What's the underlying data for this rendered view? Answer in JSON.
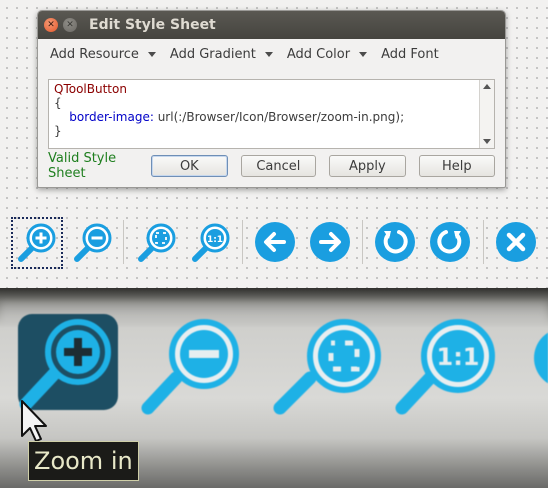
{
  "dialog": {
    "title": "Edit Style Sheet",
    "menu": [
      {
        "label": "Add Resource",
        "has_dropdown": true
      },
      {
        "label": "Add Gradient",
        "has_dropdown": true
      },
      {
        "label": "Add Color",
        "has_dropdown": true
      },
      {
        "label": "Add Font",
        "has_dropdown": false
      }
    ],
    "editor": {
      "line1": "QToolButton",
      "line2": "{",
      "line3_prop": "border-image:",
      "line3_value": " url(:/Browser/Icon/Browser/zoom-in.png);",
      "line4": "}"
    },
    "status": "Valid Style Sheet",
    "buttons": {
      "ok": "OK",
      "cancel": "Cancel",
      "apply": "Apply",
      "help": "Help"
    }
  },
  "toolbar_icons": [
    "zoom-in-icon",
    "zoom-out-icon",
    "zoom-fit-icon",
    "zoom-original-icon",
    "back-arrow-icon",
    "forward-arrow-icon",
    "rotate-left-icon",
    "rotate-right-icon",
    "close-icon"
  ],
  "tooltip": {
    "text": "Zoom in"
  },
  "colors": {
    "icon_blue": "#1a9ee0",
    "status_green": "#1f7f1f",
    "titlebar": "#4f4e49"
  }
}
